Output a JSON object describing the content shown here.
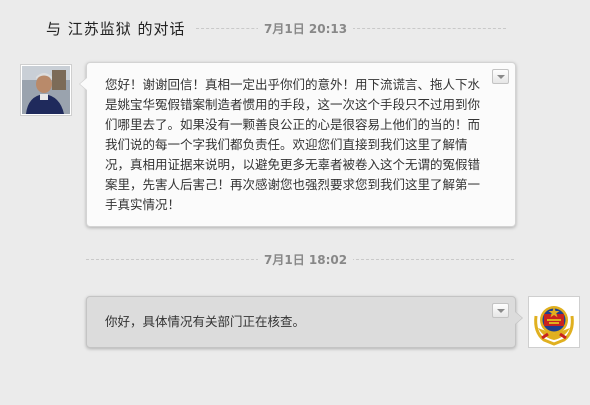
{
  "header": {
    "title": "与 江苏监狱 的对话"
  },
  "messages": [
    {
      "date": "7月1日 20:13",
      "side": "left",
      "avatar": "user-photo-avatar",
      "text": "您好！谢谢回信！真相一定出乎你们的意外！用下流谎言、拖人下水是姚宝华冤假错案制造者惯用的手段，这一次这个手段只不过用到你们哪里去了。如果没有一颗善良公正的心是很容易上他们的当的！而我们说的每一个字我们都负责任。欢迎您们直接到我们这里了解情况，真相用证据来说明，以避免更多无辜者被卷入这个无谓的冤假错案里，先害人后害己！再次感谢您也强烈要求您到我们这里了解第一手真实情况！"
    },
    {
      "date": "7月1日 18:02",
      "side": "right",
      "avatar": "police-emblem-avatar",
      "text": "你好，具体情况有关部门正在核查。"
    }
  ],
  "colors": {
    "background": "#ebebeb",
    "bubble_left": "#fbfbfb",
    "bubble_right": "#dcdcdc",
    "emblem_red": "#c8231f",
    "emblem_gold": "#e0b020"
  }
}
